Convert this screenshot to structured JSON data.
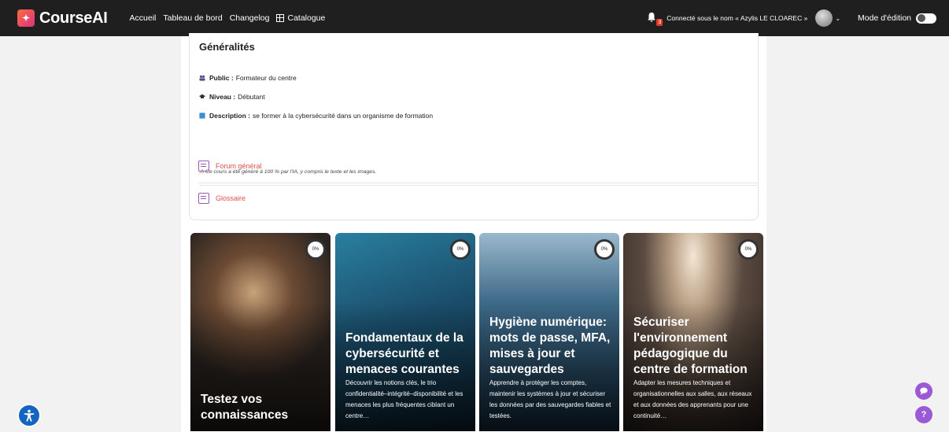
{
  "brand": {
    "name": "CourseAI",
    "logo_text": "✦"
  },
  "nav": {
    "items": [
      "Accueil",
      "Tableau de bord",
      "Changelog",
      "Catalogue"
    ],
    "notifications_count": "3",
    "logged_in_text": "Connecté sous le nom « Azylis LE CLOAREC »",
    "edit_mode_label": "Mode d'édition"
  },
  "section": {
    "title": "Généralités",
    "public_label": "Public :",
    "public_value": "Formateur du centre",
    "level_label": "Niveau :",
    "level_value": "Débutant",
    "description_label": "Description :",
    "description_value": "se former à la cybersécurité dans un organisme de formation",
    "ai_note": "⚠ Ce cours a été généré à 100 % par l'IA, y compris le texte et les images.",
    "activities": [
      {
        "label": "Forum général",
        "icon": "forum-icon"
      },
      {
        "label": "Glossaire",
        "icon": "glossary-icon"
      }
    ]
  },
  "tiles": [
    {
      "title": "Testez vos connaissances",
      "description": "",
      "progress": "0%",
      "progress_value": 0,
      "bg": "#3b2f28"
    },
    {
      "title": "Fondamentaux de la cybersécurité et menaces courantes",
      "description": "Découvrir les notions clés, le trio confidentialité–intégrité–disponibilité et les menaces les plus fréquentes ciblant un centre…",
      "progress": "0%",
      "progress_value": 0,
      "bg": "#1d4f66"
    },
    {
      "title": "Hygiène numérique: mots de passe, MFA, mises à jour et sauvegardes",
      "description": "Apprendre à protéger les comptes, maintenir les systèmes à jour et sécuriser les données par des sauvegardes fiables et testées.",
      "progress": "0%",
      "progress_value": 0,
      "bg": "#1f3a52"
    },
    {
      "title": "Sécuriser l'environnement pédagogique du centre de formation",
      "description": "Adapter les mesures techniques et organisationnelles aux salles, aux réseaux et aux données des apprenants pour une continuité…",
      "progress": "0%",
      "progress_value": 0,
      "bg": "#4a3f38"
    }
  ],
  "floating": {
    "accessibility_icon": "accessibility-icon",
    "chat_icon": "chat-icon",
    "help_label": "?"
  },
  "colors": {
    "topbar": "#1f1f1f",
    "accent": "#d9534f",
    "activity_icon": "#9b59b6",
    "fab": "#9b59d6"
  }
}
